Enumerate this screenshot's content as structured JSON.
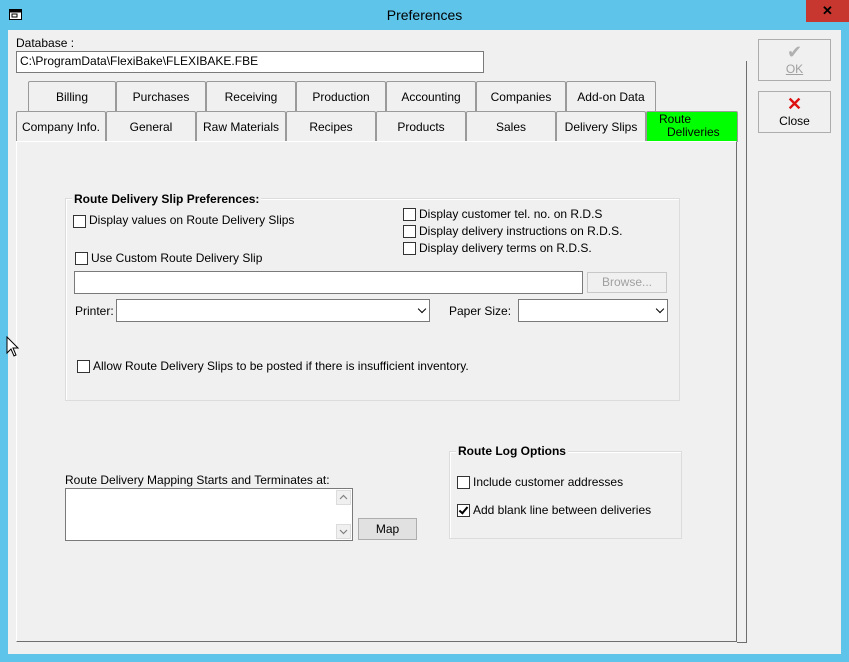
{
  "window": {
    "title": "Preferences"
  },
  "database": {
    "label": "Database :",
    "value": "C:\\ProgramData\\FlexiBake\\FLEXIBAKE.FBE"
  },
  "buttons": {
    "ok": "OK",
    "close": "Close"
  },
  "tabs_row1": [
    "Billing",
    "Purchases",
    "Receiving",
    "Production",
    "Accounting",
    "Companies",
    "Add-on Data"
  ],
  "tabs_row2": [
    "Company Info.",
    "General",
    "Raw Materials",
    "Recipes",
    "Products",
    "Sales",
    "Delivery Slips"
  ],
  "active_tab": {
    "line1": "Route",
    "line2": "Deliveries",
    "color": "#00ff00"
  },
  "slip_prefs": {
    "title": "Route Delivery Slip Preferences:",
    "display_values": {
      "label": "Display values on Route Delivery Slips",
      "checked": false
    },
    "use_custom": {
      "label": "Use Custom Route Delivery Slip",
      "checked": false
    },
    "custom_path": "",
    "browse": "Browse...",
    "display_tel": {
      "label": "Display customer tel. no. on R.D.S",
      "checked": false
    },
    "display_instructions": {
      "label": "Display delivery instructions on R.D.S.",
      "checked": false
    },
    "display_terms": {
      "label": "Display delivery terms on R.D.S.",
      "checked": false
    },
    "printer_label": "Printer:",
    "printer_value": "",
    "paper_label": "Paper Size:",
    "paper_value": "",
    "allow_post": {
      "label": "Allow Route Delivery Slips to be posted if there is insufficient inventory.",
      "checked": false
    }
  },
  "mapping": {
    "label": "Route Delivery Mapping Starts and Terminates at:",
    "value": "",
    "map_button": "Map"
  },
  "route_log": {
    "title": "Route Log Options",
    "include_addresses": {
      "label": "Include customer addresses",
      "checked": false
    },
    "blank_line": {
      "label": "Add blank line between deliveries",
      "checked": true
    }
  }
}
